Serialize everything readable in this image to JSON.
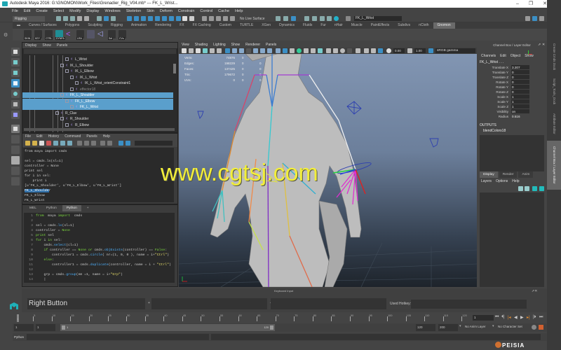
{
  "window": {
    "title": "Autodesk Maya 2016: G:\\GNOMON\\Work_Files\\Grenadier_Rig_V04.mb*  ---  FK_L_Wrist...",
    "controls": [
      "–",
      "❐",
      "✕"
    ]
  },
  "menubar": [
    "File",
    "Edit",
    "Create",
    "Select",
    "Modify",
    "Display",
    "Windows",
    "Skeleton",
    "Skin",
    "Deform",
    "Constrain",
    "Control",
    "Cache",
    "Help"
  ],
  "statusline": {
    "mode": "Rigging",
    "live_surface": "No Live Surface",
    "object_field": "FK_L_Wrist"
  },
  "shelf": {
    "tabs": [
      "Curves / Surfaces",
      "Polygons",
      "Sculpting",
      "Rigging",
      "Animation",
      "Rendering",
      "FX",
      "FX Caching",
      "Custom",
      "TURTLE",
      "XGen",
      "Dynamics",
      "Fluids",
      "Fur",
      "nHair",
      "Muscle",
      "PaintEffects",
      "Subdivs",
      "nCloth",
      "Gnomon"
    ],
    "active_tab": "Gnomon",
    "buttons": [
      "SKIN",
      "KEY",
      "CTRL",
      "DYNPA",
      "",
      "LRA",
      "",
      "",
      "Sel",
      "CVs"
    ]
  },
  "outliner": {
    "menu": [
      "Display",
      "Show",
      "Panels"
    ],
    "rows": [
      {
        "name": "L_Wrist",
        "indent": 3,
        "selected": false
      },
      {
        "name": "IK_L_Shoulder",
        "indent": 2,
        "selected": false
      },
      {
        "name": "IK_L_Elbow",
        "indent": 3,
        "selected": false
      },
      {
        "name": "IK_L_Wrist",
        "indent": 4,
        "selected": false
      },
      {
        "name": "IK_L_Wrist_orientConstraint1",
        "indent": 5,
        "selected": false
      },
      {
        "name": "effector18",
        "indent": 4,
        "selected": false
      },
      {
        "name": "FK_L_Shoulder",
        "indent": 2,
        "selected": true
      },
      {
        "name": "FK_L_Elbow",
        "indent": 3,
        "selected": true
      },
      {
        "name": "FK_L_Wrist",
        "indent": 4,
        "selected": true
      },
      {
        "name": "R_Clav",
        "indent": 1,
        "selected": false
      },
      {
        "name": "R_Shoulder",
        "indent": 2,
        "selected": false
      },
      {
        "name": "R_Elbow",
        "indent": 3,
        "selected": false
      }
    ]
  },
  "script_editor": {
    "menu": [
      "File",
      "Edit",
      "History",
      "Command",
      "Panels",
      "Help"
    ],
    "history": [
      "from maya import cmds",
      "",
      "sel = cmds.ls(sl=1)",
      "controller = None",
      "print sel",
      "for i in sel:",
      "    print i",
      "[u'FK_L_Shoulder', u'FK_L_Elbow', u'FK_L_Wrist']",
      "FK_L_Shoulder",
      "FK_L_Elbow",
      "FK_L_Wrist"
    ],
    "highlighted_text": "FK_L_Shoulde",
    "tabs": [
      "MEL",
      "Python",
      "Python",
      "+"
    ],
    "active_tab_index": 2,
    "code_lines": [
      {
        "n": "1",
        "segs": [
          [
            "kw",
            "from"
          ],
          [
            "",
            "  maya "
          ],
          [
            "kw",
            "import"
          ],
          [
            "",
            "  cmds"
          ]
        ]
      },
      {
        "n": "2",
        "segs": []
      },
      {
        "n": "3",
        "segs": [
          [
            "",
            "sel = cmds."
          ],
          [
            "bi",
            "ls"
          ],
          [
            "",
            "(sl=1)"
          ]
        ]
      },
      {
        "n": "4",
        "segs": [
          [
            "",
            "controller = "
          ],
          [
            "kw",
            "None"
          ]
        ]
      },
      {
        "n": "5",
        "segs": [
          [
            "kw",
            "print"
          ],
          [
            "",
            " sel"
          ]
        ]
      },
      {
        "n": "6",
        "segs": [
          [
            "kw",
            "for"
          ],
          [
            "",
            " i "
          ],
          [
            "kw",
            "in"
          ],
          [
            "",
            " sel:"
          ]
        ]
      },
      {
        "n": "7",
        "segs": [
          [
            "",
            "    cmds."
          ],
          [
            "bi",
            "select"
          ],
          [
            "",
            "(cl=1)"
          ]
        ]
      },
      {
        "n": "8",
        "segs": [
          [
            "",
            "    "
          ],
          [
            "kw",
            "if"
          ],
          [
            "",
            " controller == "
          ],
          [
            "kw",
            "None"
          ],
          [
            "",
            " "
          ],
          [
            "kw",
            "or"
          ],
          [
            "",
            " cmds."
          ],
          [
            "bi",
            "objExists"
          ],
          [
            "",
            "(controller) == "
          ],
          [
            "kw",
            "False"
          ],
          [
            "",
            ":"
          ]
        ]
      },
      {
        "n": "9",
        "segs": [
          [
            "",
            "        controller1 = cmds."
          ],
          [
            "bi",
            "circle"
          ],
          [
            "",
            "( nr=(1, 0, 0 ), name = i+"
          ],
          [
            "st",
            "\"Ctrl\""
          ],
          [
            "",
            ")"
          ]
        ]
      },
      {
        "n": "10",
        "segs": [
          [
            "",
            "    "
          ],
          [
            "kw",
            "else"
          ],
          [
            "",
            ":"
          ]
        ]
      },
      {
        "n": "11",
        "segs": [
          [
            "",
            "        controller1 = cmds."
          ],
          [
            "bi",
            "duplicate"
          ],
          [
            "",
            "(controller, name = i + "
          ],
          [
            "st",
            "\"Ctrl\""
          ],
          [
            "",
            ")"
          ]
        ]
      },
      {
        "n": "12",
        "segs": []
      },
      {
        "n": "13",
        "segs": [
          [
            "",
            "    grp = cmds."
          ],
          [
            "bi",
            "group"
          ],
          [
            "",
            "(em =1, name = i+"
          ],
          [
            "st",
            "\"Grp\""
          ],
          [
            "",
            ")"
          ]
        ]
      },
      {
        "n": "14",
        "segs": [
          [
            "",
            "    |"
          ]
        ]
      }
    ]
  },
  "viewport": {
    "menu": [
      "View",
      "Shading",
      "Lighting",
      "Show",
      "Renderer",
      "Panels"
    ],
    "exposure": "0.00",
    "gamma": "1.00",
    "color_space": "sRGB gamma",
    "hud": [
      {
        "label": "Verts:",
        "value": "74876",
        "a": "0",
        "b": "0"
      },
      {
        "label": "Edges:",
        "value": "198229",
        "a": "0",
        "b": "0"
      },
      {
        "label": "Faces:",
        "value": "137425",
        "a": "0",
        "b": "0"
      },
      {
        "label": "Tris:",
        "value": "179672",
        "a": "0",
        "b": "0"
      },
      {
        "label": "UVs:",
        "value": "0",
        "a": "0",
        "b": "0"
      }
    ],
    "watermark": "www.cgtsj.com"
  },
  "channel_box": {
    "title": "Channel Box / Layer Editor",
    "menu": [
      "Channels",
      "Edit",
      "Object",
      "Show"
    ],
    "node": "FK_L_Wrist . . .",
    "attributes": [
      {
        "name": "Translate X",
        "value": "3.207"
      },
      {
        "name": "Translate Y",
        "value": "0"
      },
      {
        "name": "Translate Z",
        "value": "0"
      },
      {
        "name": "Rotate X",
        "value": "0"
      },
      {
        "name": "Rotate Y",
        "value": "0"
      },
      {
        "name": "Rotate Z",
        "value": "0"
      },
      {
        "name": "Scale X",
        "value": "1"
      },
      {
        "name": "Scale Y",
        "value": "1"
      },
      {
        "name": "Scale Z",
        "value": "1"
      },
      {
        "name": "Visibility",
        "value": "on"
      },
      {
        "name": "Radius",
        "value": "0.516"
      }
    ],
    "outputs_label": "OUTPUTS",
    "outputs": [
      "blendColors18"
    ]
  },
  "layer_editor": {
    "tabs": [
      "Display",
      "Render",
      "Anim"
    ],
    "active_tab": "Display",
    "menu": [
      "Layers",
      "Options",
      "Help"
    ]
  },
  "side_tabs": [
    "Create Cmds Dock",
    "Script_Tools_Dock",
    "Attribute Editor",
    "Channel Box / Layer Editor"
  ],
  "hotkey_panel": {
    "title": "Keyboard Input",
    "button": "Right Button",
    "plus1": "+",
    "plus2": "+",
    "used_hotkey_label": "Used Hotkey:"
  },
  "time_slider": {
    "ticks": [
      "5",
      "10",
      "15",
      "20",
      "25",
      "30",
      "35",
      "40",
      "45",
      "50",
      "55",
      "60",
      "65",
      "70",
      "75",
      "80",
      "85",
      "90",
      "95",
      "100",
      "105",
      "110",
      "115",
      "120"
    ],
    "current_frame": "1",
    "current_frame_field": "1"
  },
  "range_slider": {
    "start": "1",
    "playback_start": "1",
    "range_start_label": "1",
    "range_end_label": "120",
    "playback_end": "120",
    "end": "200",
    "anim_layer": "No Anim Layer",
    "character_set": "No Character Set"
  },
  "command_line": {
    "language": "Python"
  },
  "playback_controls": [
    "⏮",
    "⏴|",
    "|◂",
    "◀",
    "▶",
    "▸|",
    "|⏵",
    "⏭"
  ],
  "brand_watermark": "PEISIA"
}
